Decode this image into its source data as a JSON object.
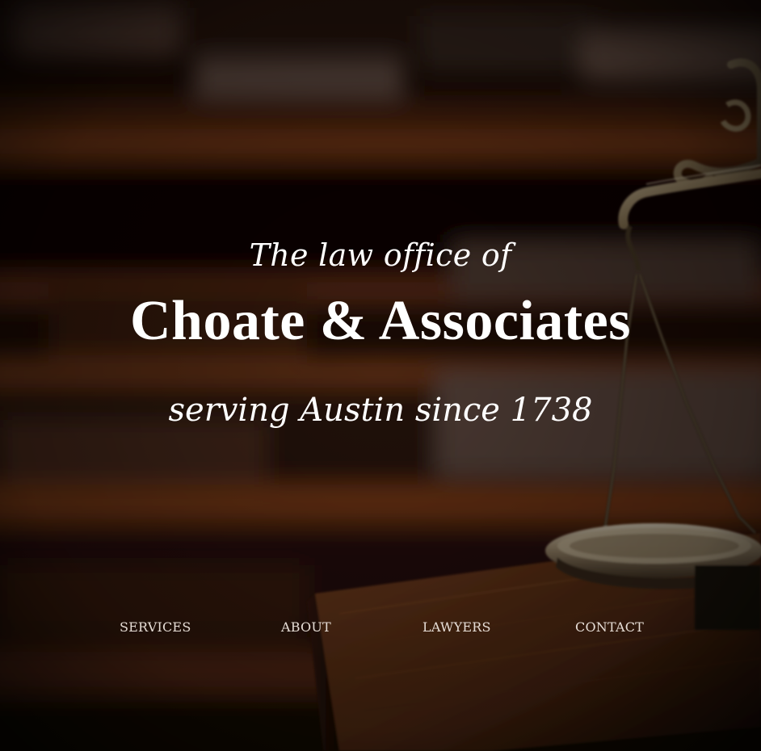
{
  "hero": {
    "intro": "The law office of",
    "firm_name": "Choate & Associates",
    "tagline": "serving Austin since 1738"
  },
  "nav": {
    "items": [
      {
        "label": "SERVICES"
      },
      {
        "label": "ABOUT"
      },
      {
        "label": "LAWYERS"
      },
      {
        "label": "CONTACT"
      }
    ]
  },
  "background": {
    "subject": "scales-of-justice-photo",
    "tone": "#3a1c0d"
  }
}
